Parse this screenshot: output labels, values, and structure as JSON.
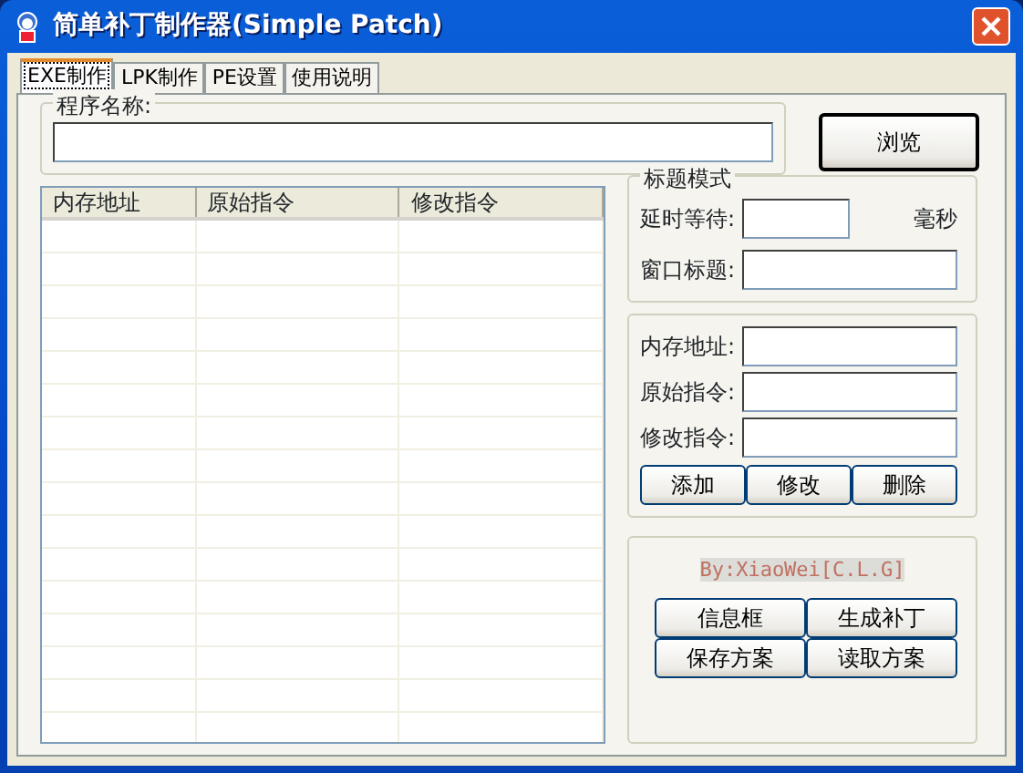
{
  "window": {
    "title": "简单补丁制作器(Simple Patch)"
  },
  "tabs": [
    {
      "label": "EXE制作",
      "selected": true
    },
    {
      "label": "LPK制作",
      "selected": false
    },
    {
      "label": "PE设置",
      "selected": false
    },
    {
      "label": "使用说明",
      "selected": false
    }
  ],
  "program_name": {
    "label": "程序名称:",
    "browse_button": "浏览"
  },
  "patch_list": {
    "columns": [
      "内存地址",
      "原始指令",
      "修改指令"
    ]
  },
  "title_mode": {
    "label": "标题模式",
    "delay_label": "延时等待:",
    "delay_unit": "毫秒",
    "window_title_label": "窗口标题:"
  },
  "instruction_fields": [
    "内存地址:",
    "原始指令:",
    "修改指令:"
  ],
  "edit_buttons": [
    "添加",
    "修改",
    "删除"
  ],
  "credit": "By:XiaoWei[C.L.G]",
  "action_buttons": [
    "信息框",
    "生成补丁",
    "保存方案",
    "读取方案"
  ]
}
